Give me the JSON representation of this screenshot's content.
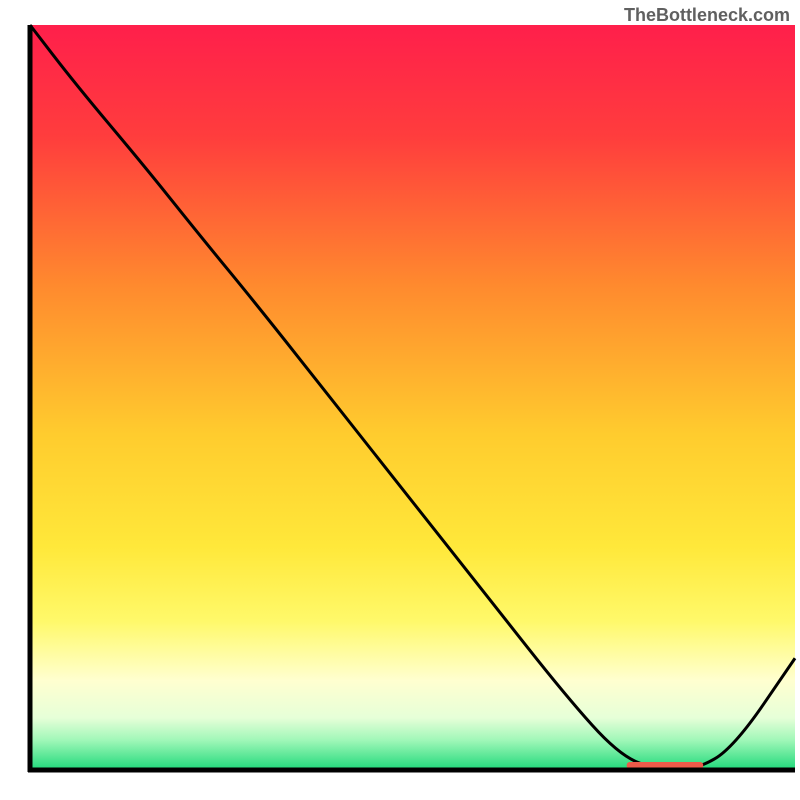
{
  "watermark": "TheBottleneck.com",
  "chart_data": {
    "type": "line",
    "title": "",
    "xlabel": "",
    "ylabel": "",
    "xlim": [
      0,
      100
    ],
    "ylim": [
      0,
      100
    ],
    "background_gradient": {
      "stops": [
        {
          "offset": 0,
          "color": "#ff1f4b"
        },
        {
          "offset": 15,
          "color": "#ff3d3d"
        },
        {
          "offset": 35,
          "color": "#ff8a2e"
        },
        {
          "offset": 55,
          "color": "#ffcc2e"
        },
        {
          "offset": 70,
          "color": "#ffe83a"
        },
        {
          "offset": 80,
          "color": "#fff96a"
        },
        {
          "offset": 88,
          "color": "#ffffd0"
        },
        {
          "offset": 93,
          "color": "#e6ffd8"
        },
        {
          "offset": 96,
          "color": "#a0f7b8"
        },
        {
          "offset": 100,
          "color": "#1fd97a"
        }
      ]
    },
    "series": [
      {
        "name": "curve",
        "x": [
          0,
          6,
          15,
          22,
          30,
          40,
          50,
          60,
          70,
          77,
          82,
          87,
          92,
          100
        ],
        "y": [
          100,
          92,
          81,
          72,
          62,
          49,
          36,
          23,
          10,
          2,
          0,
          0,
          3,
          15
        ]
      }
    ],
    "marker_segment": {
      "x_start": 78,
      "x_end": 88,
      "color": "#ed5a4a"
    }
  }
}
